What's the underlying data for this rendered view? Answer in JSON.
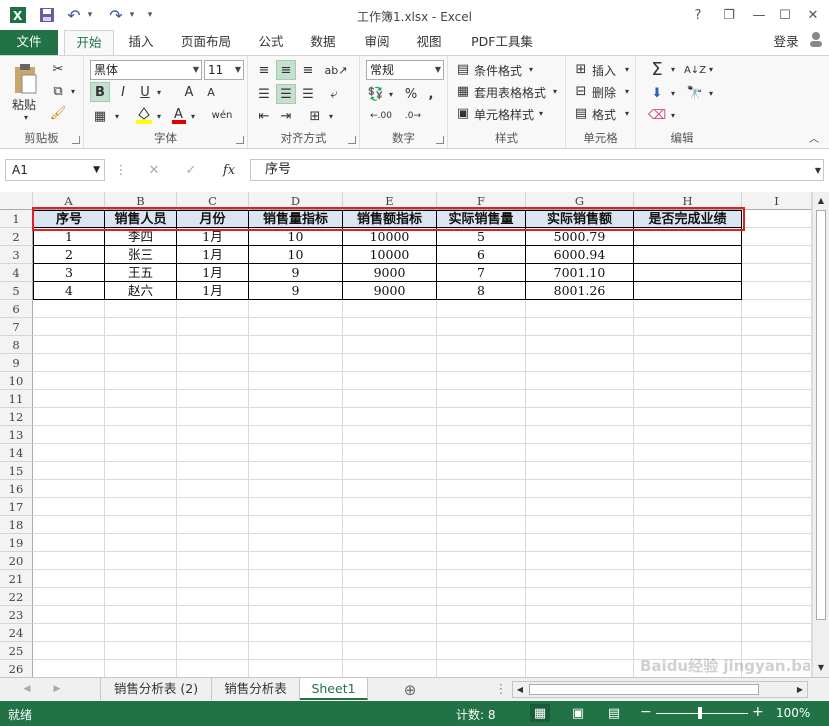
{
  "window": {
    "title": "工作簿1.xlsx - Excel",
    "help": "?",
    "minimize": "—",
    "maximize": "☐",
    "close": "✕",
    "restore": "❐"
  },
  "qat": {
    "excel_icon": "X",
    "save_icon": "save-icon",
    "undo": "↶",
    "redo": "↷",
    "more": "▾"
  },
  "tabs": [
    {
      "label": "文件"
    },
    {
      "label": "开始"
    },
    {
      "label": "插入"
    },
    {
      "label": "页面布局"
    },
    {
      "label": "公式"
    },
    {
      "label": "数据"
    },
    {
      "label": "审阅"
    },
    {
      "label": "视图"
    },
    {
      "label": "PDF工具集"
    }
  ],
  "login": "登录",
  "ribbon": {
    "clipboard": {
      "label": "剪贴板",
      "paste": "粘贴"
    },
    "font": {
      "label": "字体",
      "font_name": "黑体",
      "font_size": "11",
      "bold": "B",
      "italic": "I",
      "underline": "U",
      "grow": "A",
      "shrink": "A",
      "wen": "wén"
    },
    "alignment": {
      "label": "对齐方式"
    },
    "number": {
      "label": "数字",
      "format": "常规",
      "percent": "%",
      "comma": ",",
      "inc_dec": ".00",
      "dec_dec": ".0"
    },
    "styles": {
      "label": "样式",
      "conditional": "条件格式",
      "table": "套用表格格式",
      "cell": "单元格样式"
    },
    "cells": {
      "label": "单元格",
      "insert": "插入",
      "delete": "删除",
      "format": "格式"
    },
    "editing": {
      "label": "编辑",
      "sum": "Σ"
    }
  },
  "formula_bar": {
    "name_box": "A1",
    "cancel": "✕",
    "enter": "✓",
    "fx": "fx",
    "content": "序号"
  },
  "columns": [
    "A",
    "B",
    "C",
    "D",
    "E",
    "F",
    "G",
    "H",
    "I"
  ],
  "rows": [
    "1",
    "2",
    "3",
    "4",
    "5",
    "6",
    "7",
    "8",
    "9",
    "10",
    "11",
    "12",
    "13",
    "14",
    "15",
    "16",
    "17",
    "18",
    "19",
    "20",
    "21",
    "22",
    "23",
    "24",
    "25",
    "26"
  ],
  "table": {
    "headers": [
      "序号",
      "销售人员",
      "月份",
      "销售量指标",
      "销售额指标",
      "实际销售量",
      "实际销售额",
      "是否完成业绩"
    ],
    "data": [
      [
        "1",
        "李四",
        "1月",
        "10",
        "10000",
        "5",
        "5000.79",
        ""
      ],
      [
        "2",
        "张三",
        "1月",
        "10",
        "10000",
        "6",
        "6000.94",
        ""
      ],
      [
        "3",
        "王五",
        "1月",
        "9",
        "9000",
        "7",
        "7001.10",
        ""
      ],
      [
        "4",
        "赵六",
        "1月",
        "9",
        "9000",
        "8",
        "8001.26",
        ""
      ]
    ]
  },
  "sheets": [
    {
      "label": "销售分析表 (2)"
    },
    {
      "label": "销售分析表"
    },
    {
      "label": "Sheet1"
    }
  ],
  "status": {
    "ready": "就绪",
    "count": "计数: 8",
    "zoom": "100%",
    "minus": "−",
    "plus": "+"
  },
  "watermark": "Baidu经验 jingyan.baidu.com"
}
